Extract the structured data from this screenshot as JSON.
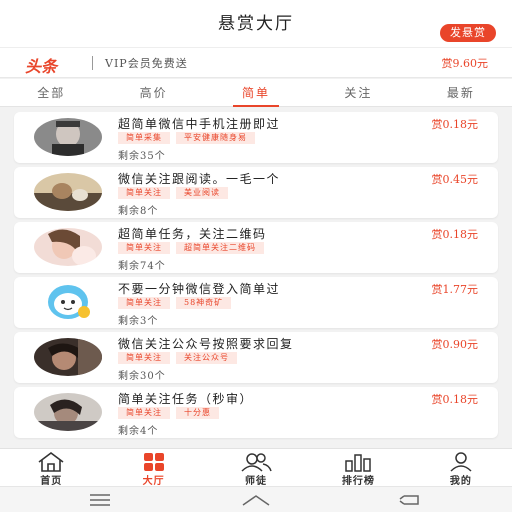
{
  "header": {
    "title": "悬赏大厅",
    "post_button": "发悬赏"
  },
  "vip_bar": {
    "logo": "头条",
    "text": "VIP会员免费送",
    "reward_total": "赏9.60元"
  },
  "tabs": [
    {
      "label": "全部"
    },
    {
      "label": "高价"
    },
    {
      "label": "简单"
    },
    {
      "label": "关注"
    },
    {
      "label": "最新"
    }
  ],
  "active_tab": "简单",
  "tasks": [
    {
      "title": "超简单微信中手机注册即过",
      "tags": [
        "简单采集",
        "平安健康随身易"
      ],
      "remaining": "剩余35个",
      "price": "赏0.18元"
    },
    {
      "title": "微信关注跟阅读。一毛一个",
      "tags": [
        "简单关注",
        "美业阅读"
      ],
      "remaining": "剩余8个",
      "price": "赏0.45元"
    },
    {
      "title": "超简单任务，关注二维码",
      "tags": [
        "简单关注",
        "超简单关注二维码"
      ],
      "remaining": "剩余74个",
      "price": "赏0.18元"
    },
    {
      "title": "不要一分钟微信登入简单过",
      "tags": [
        "简单关注",
        "58神奇矿"
      ],
      "remaining": "剩余3个",
      "price": "赏1.77元"
    },
    {
      "title": "微信关注公众号按照要求回复",
      "tags": [
        "简单关注",
        "关注公众号"
      ],
      "remaining": "剩余30个",
      "price": "赏0.90元"
    },
    {
      "title": "简单关注任务（秒审）",
      "tags": [
        "简单关注",
        "十分惠"
      ],
      "remaining": "剩余4个",
      "price": "赏0.18元"
    }
  ],
  "bottom_nav": [
    {
      "label": "首页",
      "icon": "home-icon"
    },
    {
      "label": "大厅",
      "icon": "grid-icon"
    },
    {
      "label": "师徒",
      "icon": "users-icon"
    },
    {
      "label": "排行榜",
      "icon": "bar-chart-icon"
    },
    {
      "label": "我的",
      "icon": "person-icon"
    }
  ],
  "colors": {
    "accent": "#e9452a",
    "tag_bg": "#fde8e3"
  }
}
